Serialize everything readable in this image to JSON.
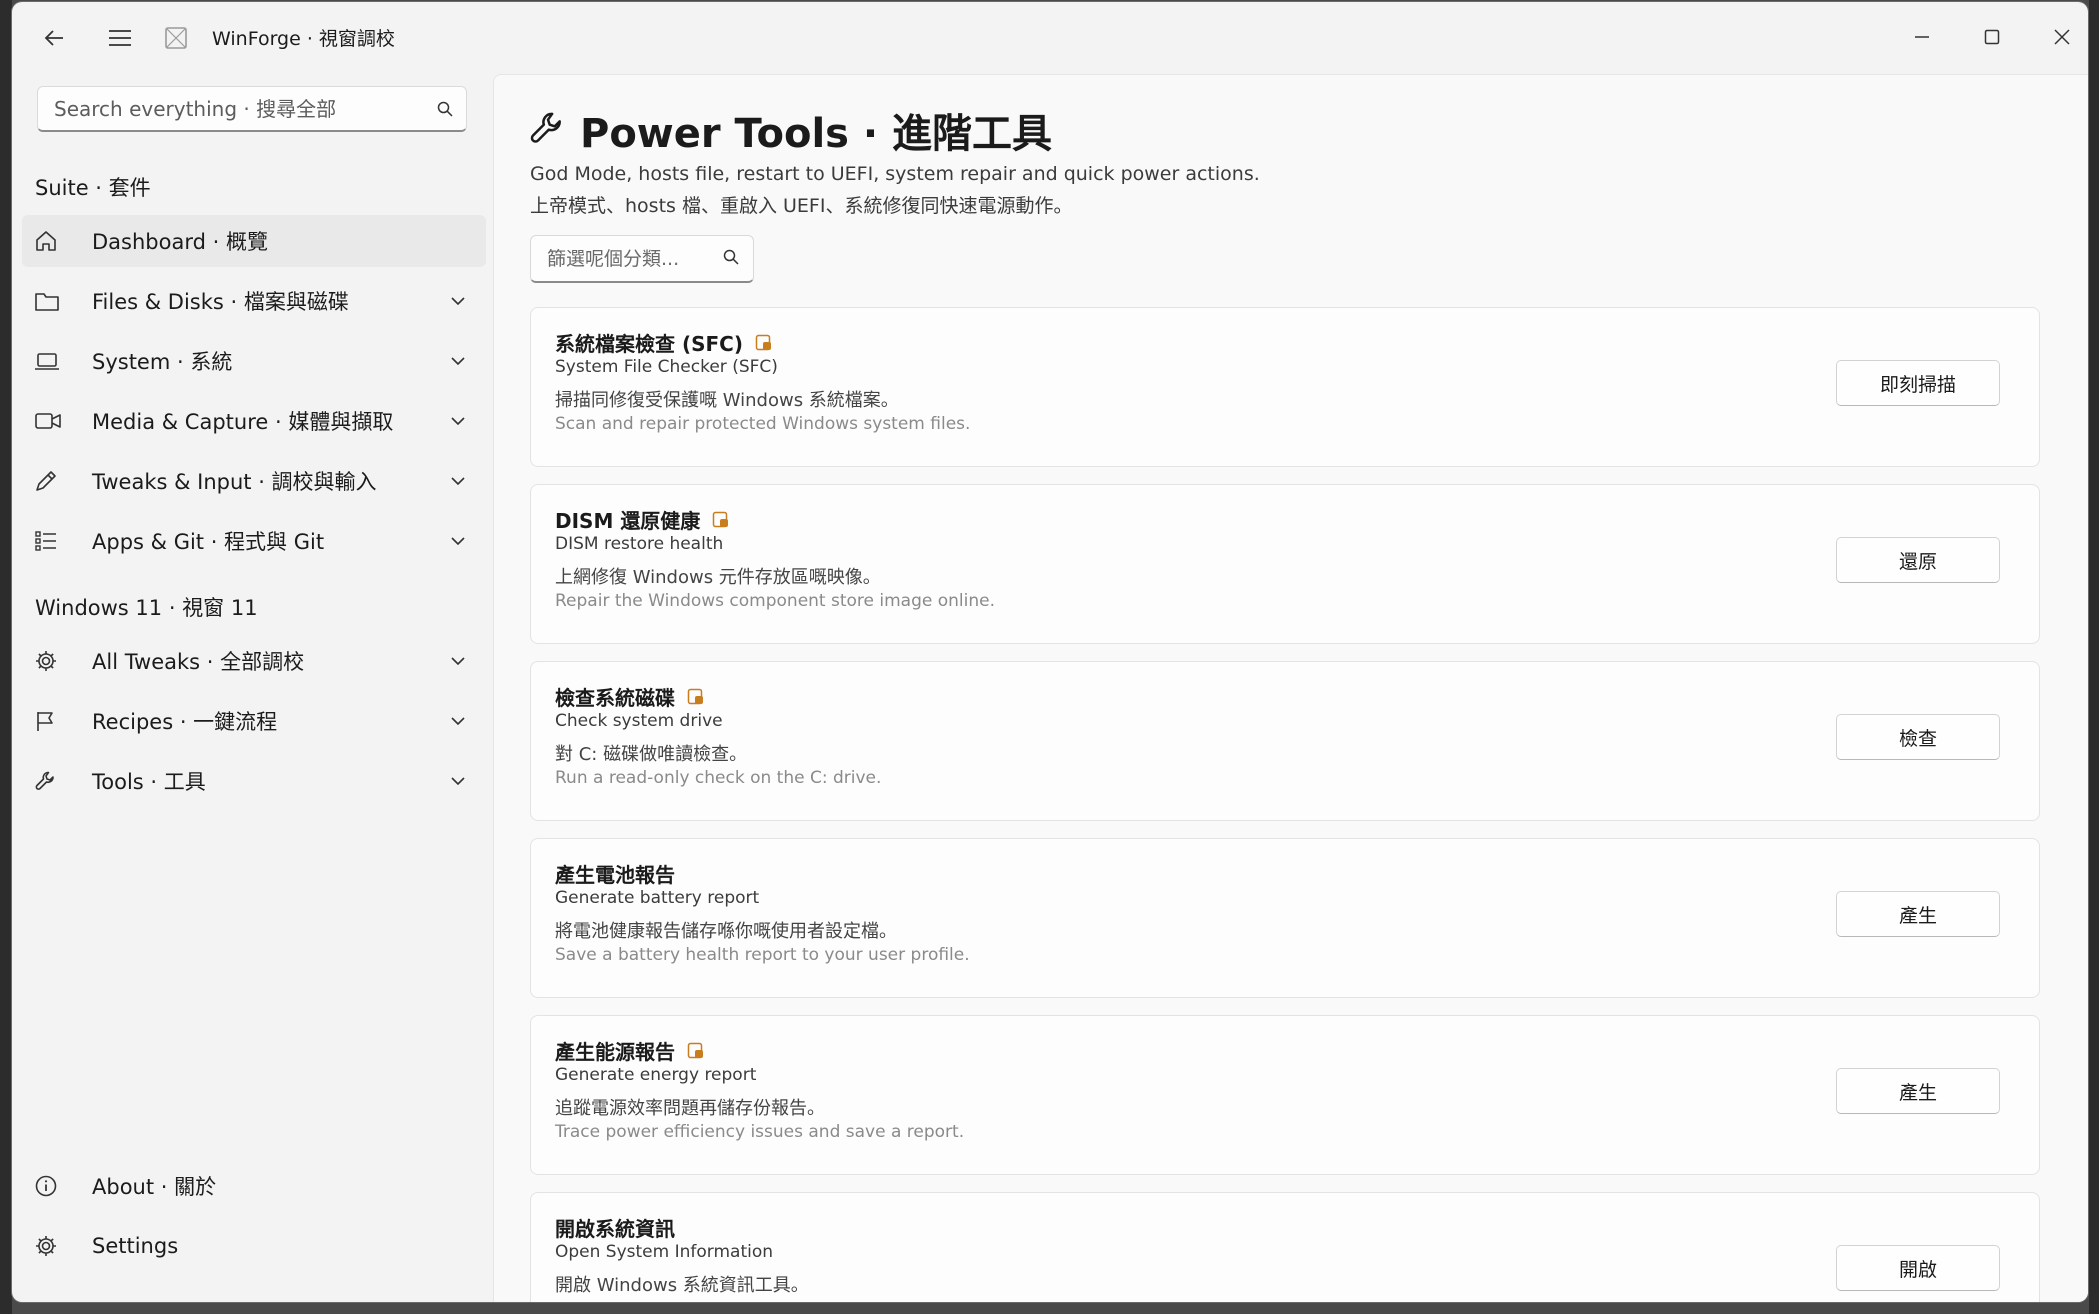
{
  "window": {
    "title": "WinForge · 視窗調校"
  },
  "sidebar": {
    "search_placeholder": "Search everything · 搜尋全部",
    "sections": [
      {
        "label": "Suite · 套件"
      },
      {
        "label": "Windows 11 · 視窗 11"
      }
    ],
    "items": [
      {
        "label": "Dashboard · 概覽",
        "icon": "home-icon"
      },
      {
        "label": "Files & Disks · 檔案與磁碟",
        "icon": "folder-icon"
      },
      {
        "label": "System · 系統",
        "icon": "laptop-icon"
      },
      {
        "label": "Media & Capture · 媒體與擷取",
        "icon": "video-camera-icon"
      },
      {
        "label": "Tweaks & Input · 調校與輸入",
        "icon": "pen-icon"
      },
      {
        "label": "Apps & Git · 程式與 Git",
        "icon": "list-icon"
      },
      {
        "label": "All Tweaks · 全部調校",
        "icon": "gear-icon"
      },
      {
        "label": "Recipes · 一鍵流程",
        "icon": "flag-icon"
      },
      {
        "label": "Tools · 工具",
        "icon": "wrench-icon"
      }
    ],
    "footer": [
      {
        "label": "About · 關於",
        "icon": "info-icon"
      },
      {
        "label": "Settings",
        "icon": "gear-icon"
      }
    ]
  },
  "page": {
    "title": "Power Tools · 進階工具",
    "subtitle_en": "God Mode, hosts file, restart to UEFI, system repair and quick power actions.",
    "subtitle_zh": "上帝模式、hosts 檔、重啟入 UEFI、系統修復同快速電源動作。",
    "filter_placeholder": "篩選呢個分類..."
  },
  "cards": [
    {
      "title": "系統檔案檢查 (SFC)",
      "title_en": "System File Checker (SFC)",
      "desc_zh": "掃描同修復受保護嘅 Windows 系統檔案。",
      "desc_en": "Scan and repair protected Windows system files.",
      "button": "即刻掃描",
      "admin": true
    },
    {
      "title": "DISM 還原健康",
      "title_en": "DISM restore health",
      "desc_zh": "上網修復 Windows 元件存放區嘅映像。",
      "desc_en": "Repair the Windows component store image online.",
      "button": "還原",
      "admin": true
    },
    {
      "title": "檢查系統磁碟",
      "title_en": "Check system drive",
      "desc_zh": "對 C: 磁碟做唯讀檢查。",
      "desc_en": "Run a read-only check on the C: drive.",
      "button": "檢查",
      "admin": true
    },
    {
      "title": "產生電池報告",
      "title_en": "Generate battery report",
      "desc_zh": "將電池健康報告儲存喺你嘅使用者設定檔。",
      "desc_en": "Save a battery health report to your user profile.",
      "button": "產生",
      "admin": false
    },
    {
      "title": "產生能源報告",
      "title_en": "Generate energy report",
      "desc_zh": "追蹤電源效率問題再儲存份報告。",
      "desc_en": "Trace power efficiency issues and save a report.",
      "button": "產生",
      "admin": true
    },
    {
      "title": "開啟系統資訊",
      "title_en": "Open System Information",
      "desc_zh": "開啟 Windows 系統資訊工具。",
      "desc_en": "",
      "button": "開啟",
      "admin": false
    }
  ],
  "colors": {
    "accent_shield": "#c87d1e",
    "selected_nav": "#e9e9e9"
  }
}
